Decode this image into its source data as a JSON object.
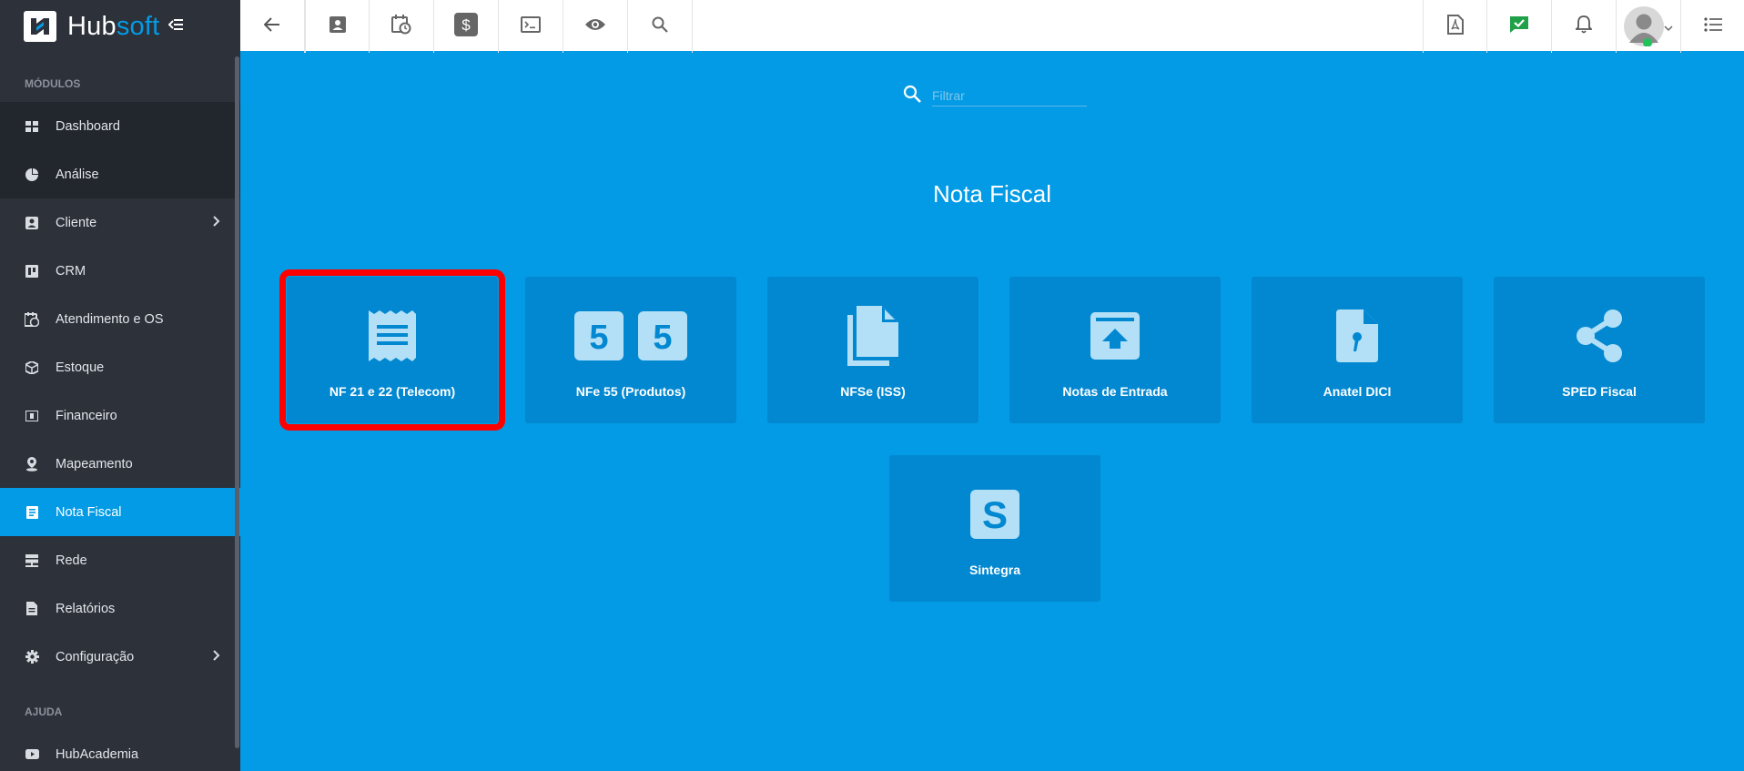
{
  "brand": {
    "name_part1": "Hub",
    "name_part2": "soft"
  },
  "sidebar": {
    "section_modules": "MÓDULOS",
    "section_help": "AJUDA",
    "items": [
      {
        "label": "Dashboard",
        "icon": "dashboard-icon"
      },
      {
        "label": "Análise",
        "icon": "pie-chart-icon"
      },
      {
        "label": "Cliente",
        "icon": "contact-card-icon"
      },
      {
        "label": "CRM",
        "icon": "kanban-icon"
      },
      {
        "label": "Atendimento e OS",
        "icon": "calendar-clock-icon"
      },
      {
        "label": "Estoque",
        "icon": "package-icon"
      },
      {
        "label": "Financeiro",
        "icon": "money-icon"
      },
      {
        "label": "Mapeamento",
        "icon": "map-pin-icon"
      },
      {
        "label": "Nota Fiscal",
        "icon": "document-icon"
      },
      {
        "label": "Rede",
        "icon": "server-icon"
      },
      {
        "label": "Relatórios",
        "icon": "report-icon"
      },
      {
        "label": "Configuração",
        "icon": "gear-icon"
      }
    ],
    "help_items": [
      {
        "label": "HubAcademia",
        "icon": "youtube-icon"
      }
    ]
  },
  "main": {
    "filter_placeholder": "Filtrar",
    "title": "Nota Fiscal",
    "tiles": [
      {
        "label": "NF 21 e 22 (Telecom)",
        "icon": "receipt-icon"
      },
      {
        "label": "NFe 55 (Produtos)",
        "icon": "number-55-icon"
      },
      {
        "label": "NFSe (ISS)",
        "icon": "file-copy-icon"
      },
      {
        "label": "Notas de Entrada",
        "icon": "archive-upload-icon"
      },
      {
        "label": "Anatel DICI",
        "icon": "file-comma-icon"
      },
      {
        "label": "SPED Fiscal",
        "icon": "share-icon"
      },
      {
        "label": "Sintegra",
        "icon": "letter-s-icon"
      }
    ]
  },
  "colors": {
    "accent": "#039be5",
    "sidebar_bg": "#2c313a",
    "tile_bg": "#0288d1",
    "highlight": "#ff0000"
  }
}
